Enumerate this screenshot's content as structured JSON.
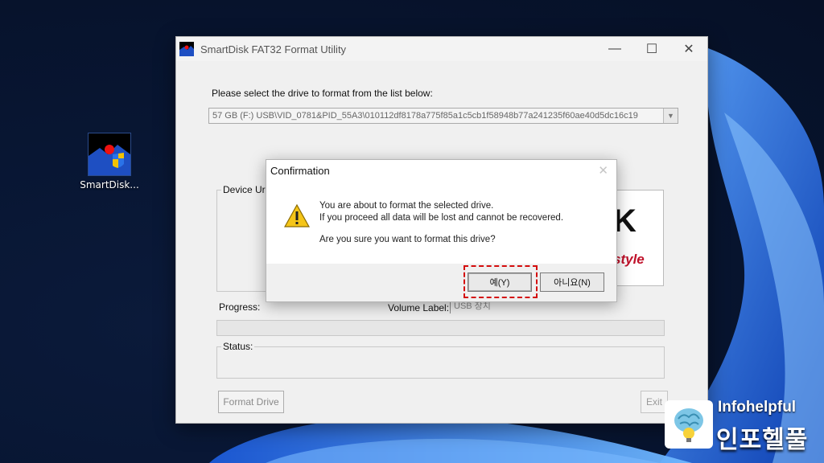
{
  "desktop": {
    "icon_label": "SmartDisk..."
  },
  "window": {
    "title": "SmartDisk FAT32 Format Utility",
    "select_prompt": "Please select the drive to format from the list below:",
    "drive_value": "57 GB  (F:) USB\\VID_0781&PID_55A3\\010112df8178a775f85a1c5cb1f58948b77a241235f60ae40d5dc16c19",
    "device_group_title": "Device Ur",
    "progress_label": "Progress:",
    "volume_label": "Volume Label:",
    "volume_value": "USB 장치",
    "status_title": "Status:",
    "format_button": "Format Drive",
    "exit_button": "Exit",
    "logo_letter": "K",
    "logo_word": "style"
  },
  "dialog": {
    "title": "Confirmation",
    "line1": "You are about to format the selected drive.",
    "line2": "If you proceed all data will be lost and cannot be recovered.",
    "line3": "Are you sure you want to format this drive?",
    "yes_button": "예(Y)",
    "no_button": "아니요(N)"
  },
  "brand": {
    "name_en": "Infohelpful",
    "name_kr": "인포헬풀"
  },
  "colors": {
    "highlight": "#d40c0c",
    "wallpaper_blue": "#1f6be0"
  }
}
